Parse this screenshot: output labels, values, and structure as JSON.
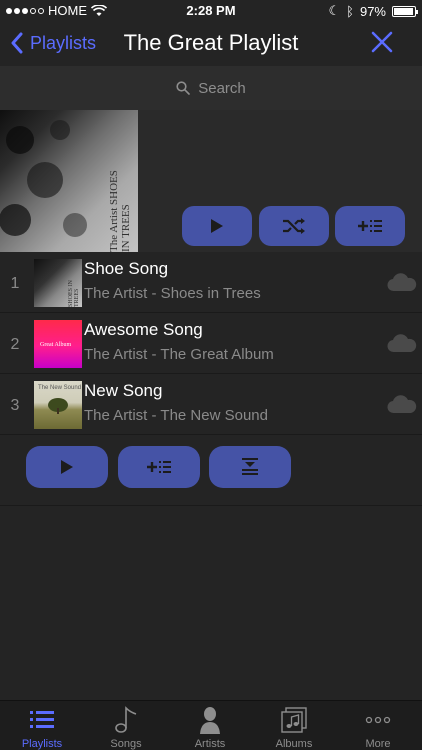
{
  "status_bar": {
    "carrier": "HOME",
    "time": "2:28 PM",
    "battery": "97%"
  },
  "nav": {
    "back_label": "Playlists",
    "title": "The Great Playlist"
  },
  "search": {
    "placeholder": "Search"
  },
  "header": {
    "art_text": "The Artist  SHOES IN TREES"
  },
  "tracks": [
    {
      "num": "1",
      "title": "Shoe Song",
      "subtitle": "The Artist - Shoes in Trees",
      "art_text": "SHOES IN TREES"
    },
    {
      "num": "2",
      "title": "Awesome Song",
      "subtitle": "The Artist - The Great Album",
      "art_text": "Great Album"
    },
    {
      "num": "3",
      "title": "New Song",
      "subtitle": "The Artist - The New Sound",
      "art_text": "The New Sound"
    }
  ],
  "tabs": [
    {
      "label": "Playlists",
      "icon": "list-icon",
      "active": true
    },
    {
      "label": "Songs",
      "icon": "music-note-icon"
    },
    {
      "label": "Artists",
      "icon": "artist-icon"
    },
    {
      "label": "Albums",
      "icon": "albums-icon"
    },
    {
      "label": "More",
      "icon": "more-icon"
    }
  ],
  "colors": {
    "accent": "#5b6cff",
    "button": "#4553a6",
    "background": "#242424"
  }
}
